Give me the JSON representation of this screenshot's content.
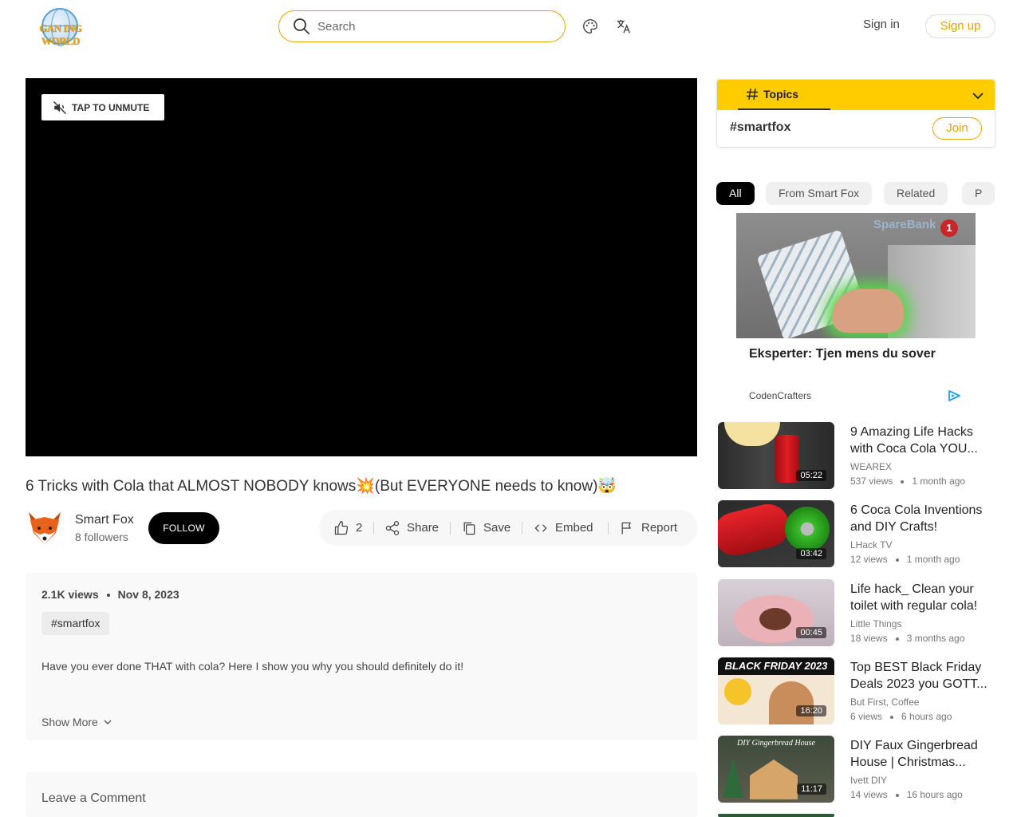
{
  "header": {
    "logo_text": "GAN ING WORLD",
    "search_placeholder": "Search",
    "signin_label": "Sign in",
    "signup_label": "Sign up"
  },
  "player": {
    "unmute_label": "TAP TO UNMUTE"
  },
  "video": {
    "title": "6 Tricks with Cola that ALMOST NOBODY knows💥(But EVERYONE needs to know)🤯",
    "channel_name": "Smart Fox",
    "followers": "8 followers",
    "follow_label": "FOLLOW",
    "likes": "2",
    "share_label": "Share",
    "save_label": "Save",
    "embed_label": "Embed",
    "report_label": "Report",
    "views": "2.1K views",
    "date": "Nov 8, 2023",
    "tag": "#smartfox",
    "description": "Have you ever done THAT with cola? Here I show you why you should definitely do it!",
    "show_more_label": "Show More"
  },
  "comments": {
    "placeholder": "Leave a Comment"
  },
  "topics": {
    "tab_label": "Topics",
    "topic_name": "#smartfox",
    "join_label": "Join"
  },
  "filters": [
    "All",
    "From Smart Fox",
    "Related",
    "P"
  ],
  "ad": {
    "bank_text": "SpareBank",
    "badge": "1",
    "title": "Eksperter: Tjen mens du sover",
    "source": "CodenCrafters"
  },
  "related": [
    {
      "title": "9 Amazing Life Hacks with Coca Cola YOU...",
      "channel": "WEAREX",
      "views": "537 views",
      "age": "1 month ago",
      "duration": "05:22"
    },
    {
      "title": "6 Coca Cola Inventions and DIY Crafts!",
      "channel": "LHack TV",
      "views": "12 views",
      "age": "1 month ago",
      "duration": "03:42"
    },
    {
      "title": "Life hack_ Clean your toilet with regular cola!",
      "channel": "Little Things",
      "views": "18 views",
      "age": "3 months ago",
      "duration": "00:45"
    },
    {
      "title": "Top BEST Black Friday Deals 2023 you GOTT...",
      "channel": "But First, Coffee",
      "views": "6 views",
      "age": "6 hours ago",
      "duration": "16:20",
      "thumb_text": "BLACK FRIDAY 2023"
    },
    {
      "title": "DIY Faux Gingerbread House | Christmas...",
      "channel": "Ivett DIY",
      "views": "14 views",
      "age": "16 hours ago",
      "duration": "11:17",
      "thumb_text": "DIY Gingerbread House"
    }
  ],
  "colors": {
    "accent": "#e2a400",
    "topics_bar": "#ffcc00"
  }
}
